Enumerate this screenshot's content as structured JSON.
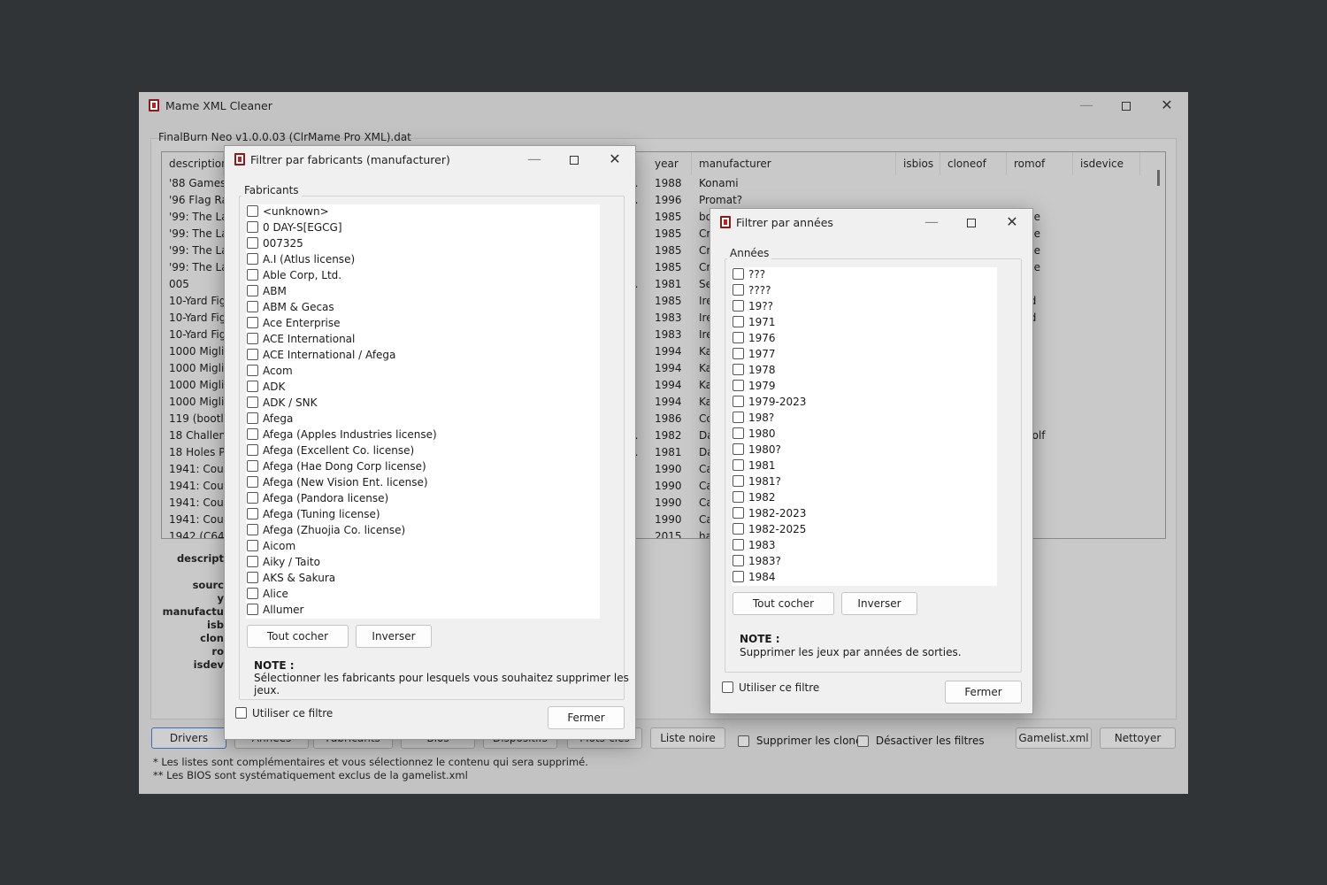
{
  "window": {
    "title": "Mame XML Cleaner",
    "file_label": "FinalBurn Neo v1.0.0.03 (ClrMame Pro XML).dat"
  },
  "table": {
    "columns": [
      "description",
      "year",
      "manufacturer",
      "isbios",
      "cloneof",
      "romof",
      "isdevice"
    ],
    "rows": [
      {
        "description": "'88 Games",
        "src": "...",
        "year": "1988",
        "manufacturer": "Konami",
        "romof": ""
      },
      {
        "description": "'96 Flag Rally",
        "src": "...",
        "year": "1996",
        "manufacturer": "Promat?",
        "romof": ""
      },
      {
        "description": "'99: The Last",
        "src": "p",
        "year": "1985",
        "manufacturer": "bo",
        "romof": "lse"
      },
      {
        "description": "'99: The Last",
        "src": "p",
        "year": "1985",
        "manufacturer": "Cr",
        "romof": "lse"
      },
      {
        "description": "'99: The Last",
        "src": "p",
        "year": "1985",
        "manufacturer": "Cr",
        "romof": "lse"
      },
      {
        "description": "'99: The Last",
        "src": "p",
        "year": "1985",
        "manufacturer": "Cr",
        "romof": "lse"
      },
      {
        "description": "005",
        "src": "...",
        "year": "1981",
        "manufacturer": "Se",
        "romof": ""
      },
      {
        "description": "10-Yard Figh",
        "src": "",
        "year": "1985",
        "manufacturer": "Ire",
        "romof": "rd"
      },
      {
        "description": "10-Yard Figh",
        "src": "",
        "year": "1983",
        "manufacturer": "Ire",
        "romof": "rd"
      },
      {
        "description": "10-Yard Figh",
        "src": "",
        "year": "1983",
        "manufacturer": "Ire",
        "romof": ""
      },
      {
        "description": "1000 Miglia:",
        "src": "..",
        "year": "1994",
        "manufacturer": "Ka",
        "romof": "r"
      },
      {
        "description": "1000 Miglia:",
        "src": "..",
        "year": "1994",
        "manufacturer": "Ka",
        "romof": "r"
      },
      {
        "description": "1000 Miglia:",
        "src": "..",
        "year": "1994",
        "manufacturer": "Ka",
        "romof": "r"
      },
      {
        "description": "1000 Miglia:",
        "src": "..",
        "year": "1994",
        "manufacturer": "Ka",
        "romof": ""
      },
      {
        "description": "119 (bootleg",
        "src": "o",
        "year": "1986",
        "manufacturer": "Co",
        "romof": ""
      },
      {
        "description": "18 Challeng",
        "src": "...",
        "year": "1982",
        "manufacturer": "Da",
        "romof": "golf"
      },
      {
        "description": "18 Holes Pro",
        "src": "...",
        "year": "1981",
        "manufacturer": "Da",
        "romof": ""
      },
      {
        "description": "1941: Count",
        "src": "p",
        "year": "1990",
        "manufacturer": "Ca",
        "romof": ""
      },
      {
        "description": "1941: Count",
        "src": "p",
        "year": "1990",
        "manufacturer": "Ca",
        "romof": ""
      },
      {
        "description": "1941: Count",
        "src": "p",
        "year": "1990",
        "manufacturer": "Ca",
        "romof": ""
      },
      {
        "description": "1941: Count",
        "src": "p",
        "year": "1990",
        "manufacturer": "Ca",
        "romof": ""
      },
      {
        "description": "1942 (C64 M",
        "src": "",
        "year": "2015",
        "manufacturer": "ha",
        "romof": ""
      }
    ]
  },
  "details": {
    "labels": [
      "descript",
      "sourc",
      "y",
      "manufactu",
      "isb",
      "clon",
      "ro",
      "isdev"
    ]
  },
  "bottom": {
    "tabs": [
      "Drivers",
      "Années",
      "Fabricants",
      "Bios",
      "Dispositifs",
      "Mots-clés"
    ],
    "liste_noire": "Liste noire",
    "supprimer_clones": "Supprimer les clones",
    "desactiver_filtres": "Désactiver les filtres",
    "gamelist": "Gamelist.xml",
    "nettoyer": "Nettoyer",
    "note1": "* Les listes sont complémentaires et vous sélectionnez le contenu qui sera supprimé.",
    "note2": "** Les BIOS sont systématiquement exclus de la gamelist.xml"
  },
  "manufacturer_dialog": {
    "title": "Filtrer par fabricants (manufacturer)",
    "group": "Fabricants",
    "items": [
      "<unknown>",
      "0 DAY-S[EGCG]",
      "007325",
      "A.I (Atlus license)",
      "Able Corp, Ltd.",
      "ABM",
      "ABM & Gecas",
      "Ace Enterprise",
      "ACE International",
      "ACE International / Afega",
      "Acom",
      "ADK",
      "ADK / SNK",
      "Afega",
      "Afega (Apples Industries license)",
      "Afega (Excellent Co. license)",
      "Afega (Hae Dong Corp license)",
      "Afega (New Vision Ent. license)",
      "Afega (Pandora license)",
      "Afega (Tuning license)",
      "Afega (Zhuojia Co. license)",
      "Aicom",
      "Aiky / Taito",
      "AKS & Sakura",
      "Alice",
      "Allumer"
    ],
    "check_all": "Tout cocher",
    "invert": "Inverser",
    "note_title": "NOTE :",
    "note_text": "Sélectionner les fabricants pour lesquels vous souhaitez supprimer les jeux.",
    "use_filter": "Utiliser ce filtre",
    "close": "Fermer"
  },
  "year_dialog": {
    "title": "Filtrer par années",
    "group": "Années",
    "items": [
      "???",
      "????",
      "19??",
      "1971",
      "1976",
      "1977",
      "1978",
      "1979",
      "1979-2023",
      "198?",
      "1980",
      "1980?",
      "1981",
      "1981?",
      "1982",
      "1982-2023",
      "1982-2025",
      "1983",
      "1983?",
      "1984"
    ],
    "check_all": "Tout cocher",
    "invert": "Inverser",
    "note_title": "NOTE :",
    "note_text": "Supprimer les jeux par années de sorties.",
    "use_filter": "Utiliser ce filtre",
    "close": "Fermer"
  },
  "colors": {
    "backdrop": "#313437",
    "main_window_dimmed": "#c3c3c3",
    "dialog_bg": "#f0f0f0",
    "active_tab_border": "#3b6fb8",
    "app_icon": "#8b1a1a"
  },
  "icons": [
    "app-icon",
    "minimize-icon",
    "maximize-icon",
    "close-icon"
  ]
}
